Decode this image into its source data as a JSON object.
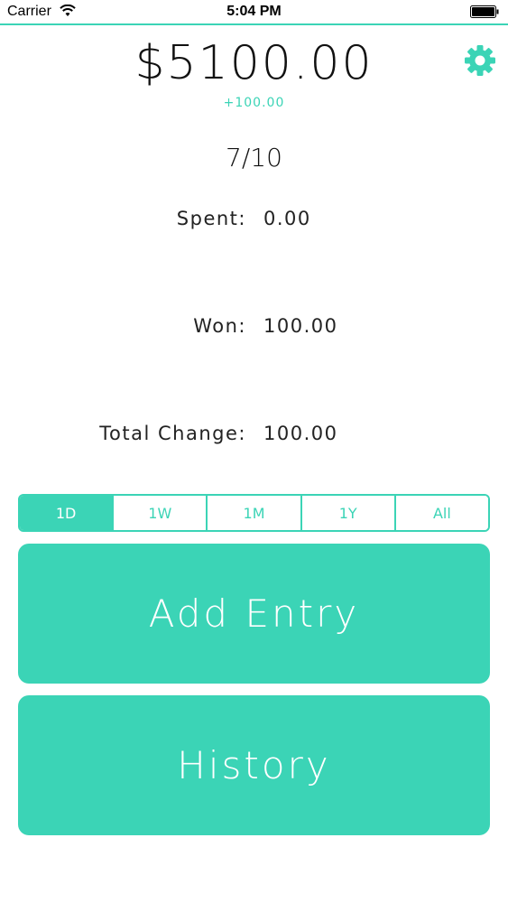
{
  "status_bar": {
    "carrier": "Carrier",
    "time": "5:04 PM"
  },
  "header": {
    "balance": "$5100.00",
    "delta": "+100.00"
  },
  "date": "7/10",
  "stats": [
    {
      "label": "Spent:",
      "value": "0.00"
    },
    {
      "label": "Won:",
      "value": "100.00"
    },
    {
      "label": "Total Change:",
      "value": "100.00"
    }
  ],
  "ranges": [
    "1D",
    "1W",
    "1M",
    "1Y",
    "All"
  ],
  "selected_range": "1D",
  "buttons": {
    "add_entry": "Add Entry",
    "history": "History"
  },
  "colors": {
    "accent": "#3bd4b6"
  },
  "icons": {
    "settings": "gear-icon",
    "wifi": "wifi-icon",
    "battery": "battery-icon"
  }
}
